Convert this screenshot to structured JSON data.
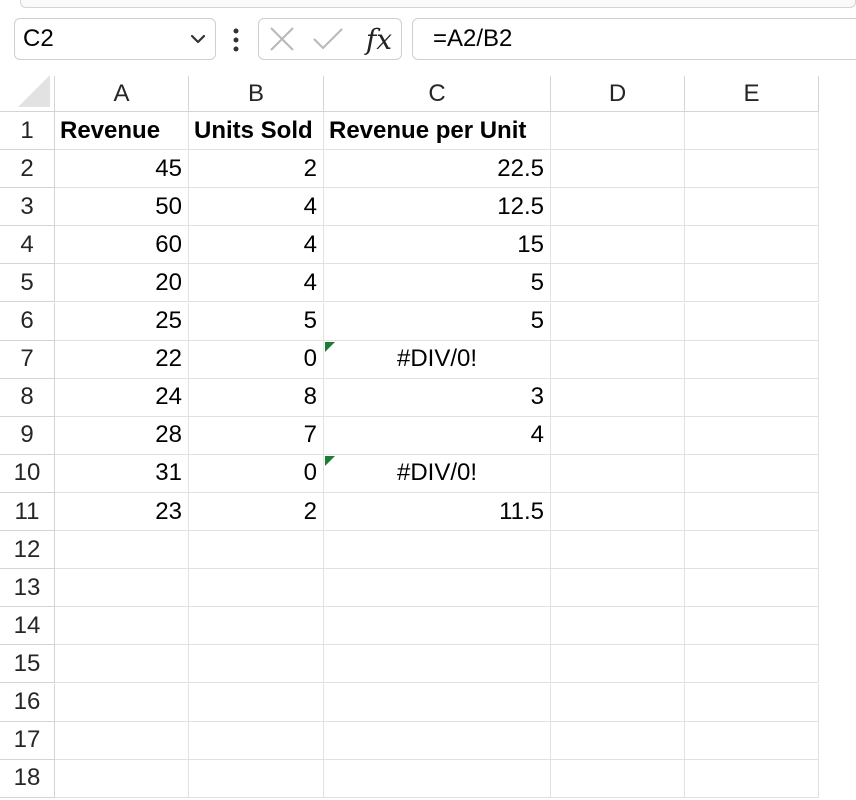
{
  "namebox": {
    "value": "C2"
  },
  "formula_bar": {
    "value": "=A2/B2"
  },
  "formula_icons": [
    "cancel-icon",
    "enter-icon",
    "insert-function-icon"
  ],
  "fx_label": "fx",
  "columns": [
    "A",
    "B",
    "C",
    "D",
    "E"
  ],
  "rows": [
    "1",
    "2",
    "3",
    "4",
    "5",
    "6",
    "7",
    "8",
    "9",
    "10",
    "11",
    "12",
    "13",
    "14",
    "15",
    "16",
    "17",
    "18"
  ],
  "headers": {
    "A": "Revenue",
    "B": "Units Sold",
    "C": "Revenue per Unit"
  },
  "data": [
    {
      "A": "45",
      "B": "2",
      "C": "22.5"
    },
    {
      "A": "50",
      "B": "4",
      "C": "12.5"
    },
    {
      "A": "60",
      "B": "4",
      "C": "15"
    },
    {
      "A": "20",
      "B": "4",
      "C": "5"
    },
    {
      "A": "25",
      "B": "5",
      "C": "5"
    },
    {
      "A": "22",
      "B": "0",
      "C": "#DIV/0!"
    },
    {
      "A": "24",
      "B": "8",
      "C": "3"
    },
    {
      "A": "28",
      "B": "7",
      "C": "4"
    },
    {
      "A": "31",
      "B": "0",
      "C": "#DIV/0!"
    },
    {
      "A": "23",
      "B": "2",
      "C": "11.5"
    }
  ],
  "error_indicator_color": "#1f7a36",
  "selected_cell": "C2"
}
